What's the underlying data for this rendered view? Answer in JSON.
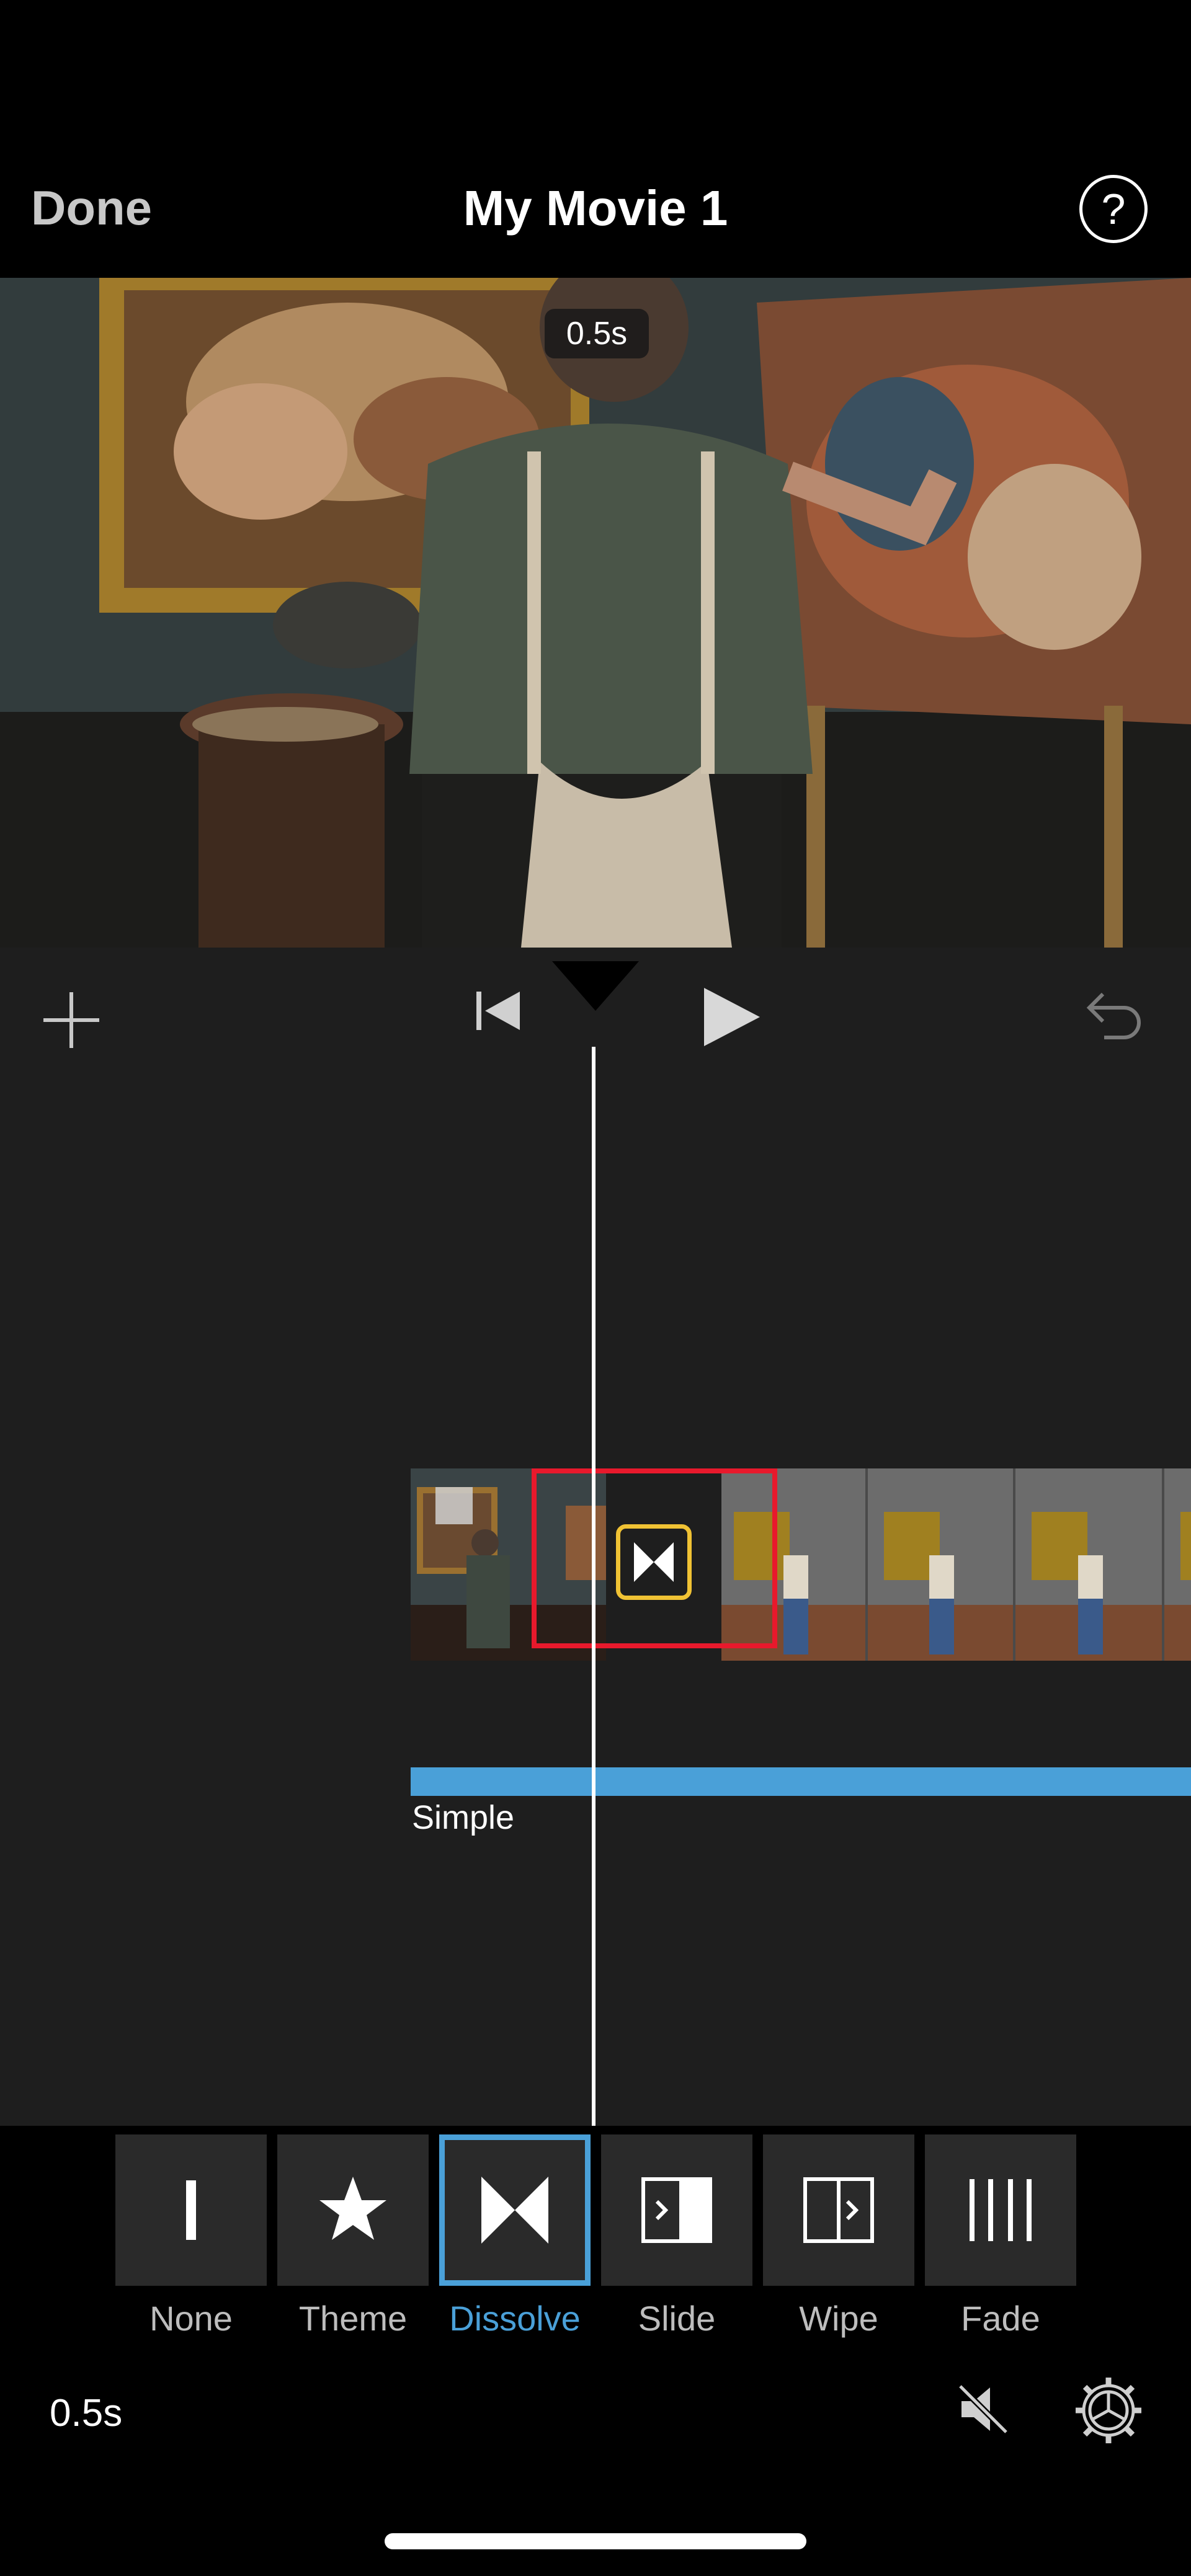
{
  "header": {
    "done_label": "Done",
    "title": "My Movie 1",
    "help_label": "?"
  },
  "preview": {
    "duration_badge": "0.5s"
  },
  "timeline": {
    "audio_label": "Simple"
  },
  "transitions": {
    "items": [
      {
        "label": "None",
        "icon": "none-bar-icon"
      },
      {
        "label": "Theme",
        "icon": "star-icon"
      },
      {
        "label": "Dissolve",
        "icon": "dissolve-icon"
      },
      {
        "label": "Slide",
        "icon": "slide-icon"
      },
      {
        "label": "Wipe",
        "icon": "wipe-icon"
      },
      {
        "label": "Fade",
        "icon": "fade-icon"
      }
    ],
    "selected": "Dissolve"
  },
  "footer": {
    "duration": "0.5s"
  },
  "colors": {
    "accent": "#4aa0d8",
    "highlight": "#e8192c",
    "transition_icon": "#f0c234"
  }
}
